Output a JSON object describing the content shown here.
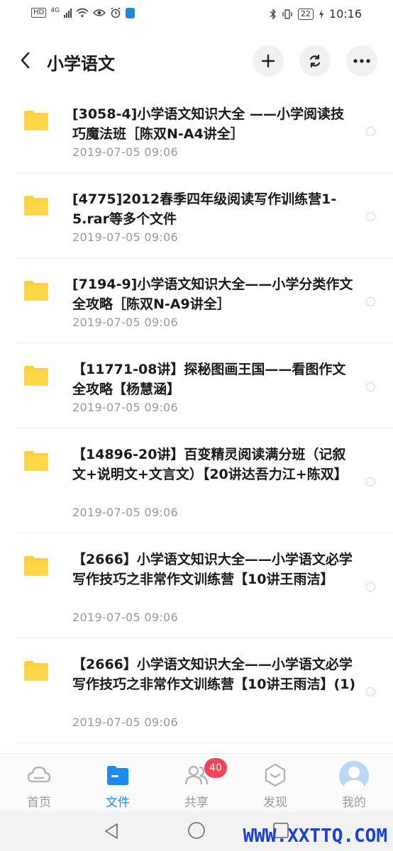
{
  "status_bar": {
    "hd": "HD",
    "network": "4G",
    "battery": "22",
    "time": "10:16"
  },
  "header": {
    "title": "小学语文",
    "icons": {
      "back": "back-icon",
      "add": "plus-icon",
      "sync": "sync-icon",
      "more": "more-icon"
    }
  },
  "files": [
    {
      "name": "[3058-4]小学语文知识大全 ——小学阅读技巧魔法班［陈双N-A4讲全］",
      "date": "2019-07-05  09:06"
    },
    {
      "name": "[4775]2012春季四年级阅读写作训练营1-5.rar等多个文件",
      "date": "2019-07-05  09:06"
    },
    {
      "name": "[7194-9]小学语文知识大全——小学分类作文全攻略［陈双N-A9讲全］",
      "date": "2019-07-05  09:06"
    },
    {
      "name": "【11771-08讲】探秘图画王国——看图作文全攻略【杨慧涵】",
      "date": "2019-07-05  09:06"
    },
    {
      "name": "【14896-20讲】百变精灵阅读满分班（记叙文+说明文+文言文）【20讲达吾力江+陈双】",
      "date": "2019-07-05  09:06"
    },
    {
      "name": "【2666】小学语文知识大全——小学语文必学写作技巧之非常作文训练营【10讲王雨洁】",
      "date": "2019-07-05  09:06"
    },
    {
      "name": "【2666】小学语文知识大全——小学语文必学写作技巧之非常作文训练营【10讲王雨洁】(1)",
      "date": "2019-07-05  09:06"
    }
  ],
  "nav": [
    {
      "label": "首页",
      "icon": "cloud-icon",
      "active": false
    },
    {
      "label": "文件",
      "icon": "folder-icon",
      "active": true
    },
    {
      "label": "共享",
      "icon": "people-icon",
      "active": false,
      "badge": "40"
    },
    {
      "label": "发现",
      "icon": "discover-icon",
      "active": false
    },
    {
      "label": "我的",
      "icon": "avatar-icon",
      "active": false
    }
  ],
  "colors": {
    "accent": "#1a8cf0",
    "folder": "#fdd13d",
    "badge": "#f0445a",
    "watermark": "#1a3fd6"
  },
  "watermark": "WWW.XXTTQ.COM"
}
